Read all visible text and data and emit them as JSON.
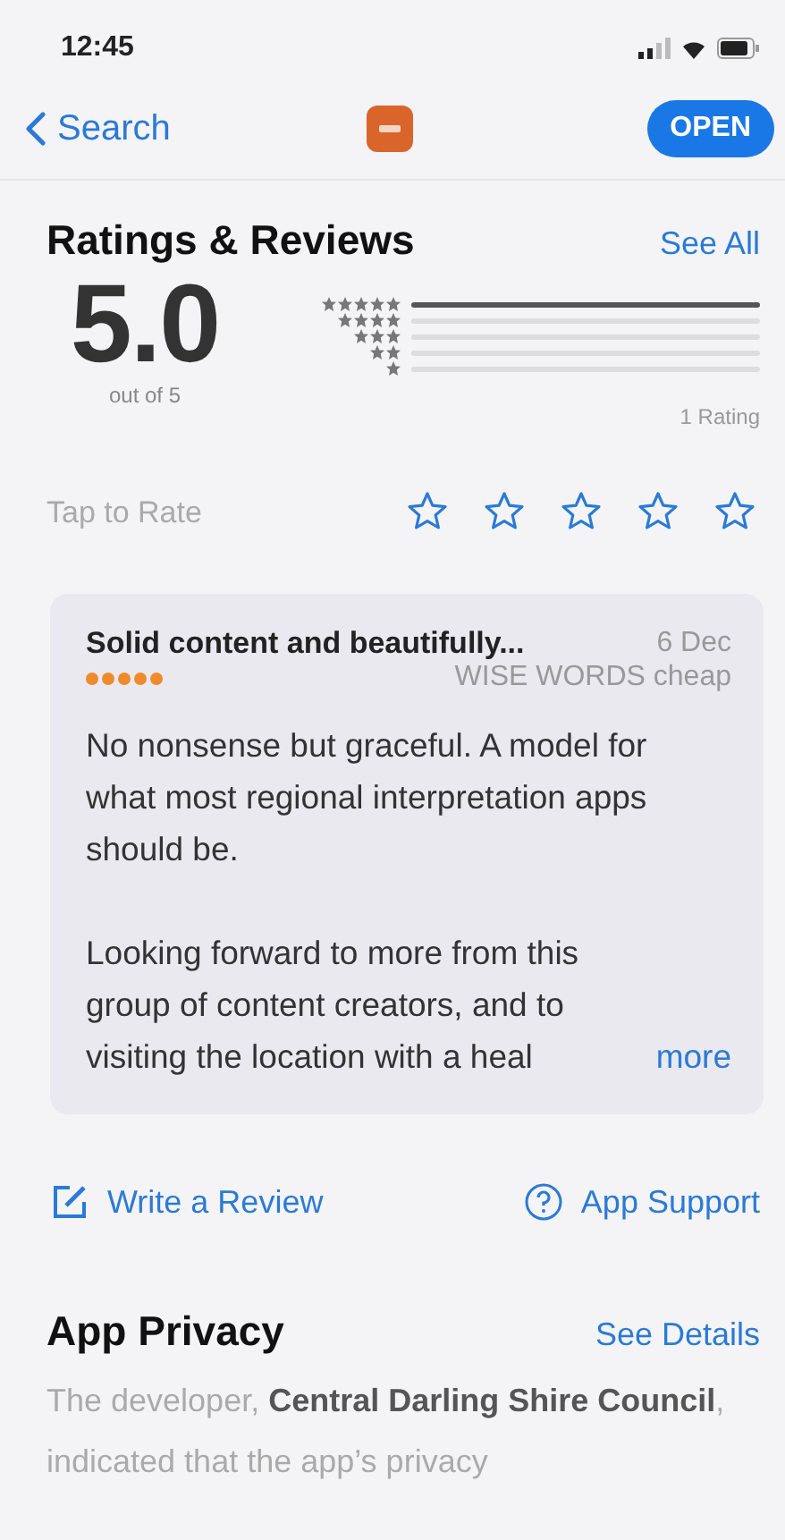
{
  "status_bar": {
    "time": "12:45"
  },
  "nav": {
    "back": "Search",
    "button": "OPEN"
  },
  "ratings": {
    "title": "Ratings & Reviews",
    "link": "See All",
    "score": "5.0",
    "out_of": "out of 5",
    "count": "1 Rating",
    "bars": [
      {
        "level": 1
      },
      {
        "level": 0
      },
      {
        "level": 0
      },
      {
        "level": 0
      },
      {
        "level": 0
      }
    ]
  },
  "tap_to_rate": {
    "label": "Tap to Rate",
    "stars": 0
  },
  "review": {
    "title": "Solid content and beautifully...",
    "date": "6 Dec",
    "stars": 5,
    "author": "WISE WORDS cheap",
    "paragraphs": [
      "No nonsense but graceful. A model for what most regional interpretation apps should be.",
      "Looking forward to more from this group of content creators, and to visiting the location with a heal"
    ],
    "more": "more"
  },
  "actions": [
    {
      "kind": "write",
      "label": "Write a Review"
    },
    {
      "kind": "support",
      "label": "App Support"
    }
  ],
  "privacy": {
    "title": "App Privacy",
    "link": "See Details",
    "text": "The developer, **Central Darling Shire Council**, indicated that the app’s privacy"
  }
}
